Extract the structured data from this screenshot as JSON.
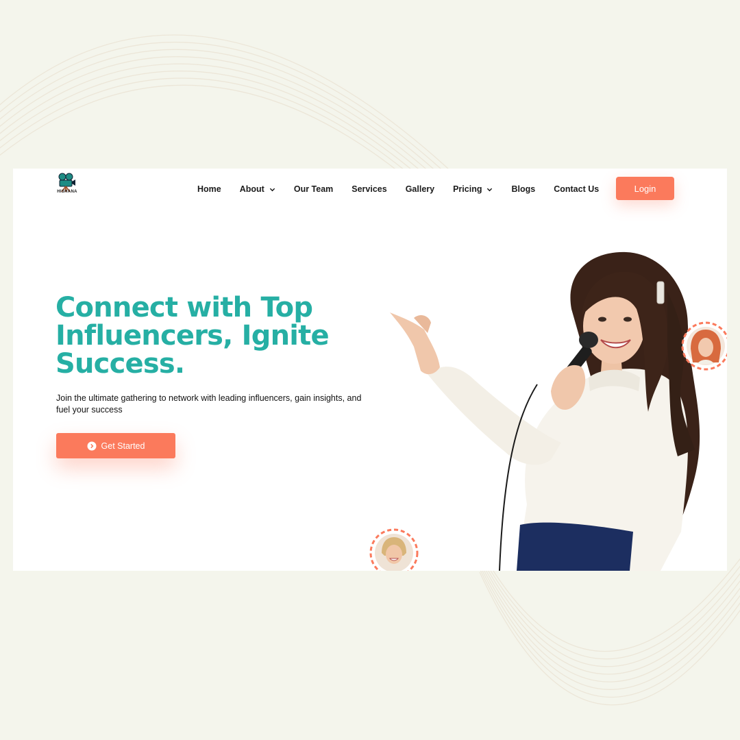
{
  "brand": {
    "name": "HISHANA"
  },
  "nav": {
    "items": [
      {
        "label": "Home",
        "dropdown": false
      },
      {
        "label": "About",
        "dropdown": true
      },
      {
        "label": "Our Team",
        "dropdown": false
      },
      {
        "label": "Services",
        "dropdown": false
      },
      {
        "label": "Gallery",
        "dropdown": false
      },
      {
        "label": "Pricing",
        "dropdown": true
      },
      {
        "label": "Blogs",
        "dropdown": false
      },
      {
        "label": "Contact Us",
        "dropdown": false
      }
    ],
    "login_label": "Login"
  },
  "hero": {
    "headline_lines": [
      "Connect with Top",
      "Influencers, Ignite",
      "Success."
    ],
    "subtitle": "Join the ultimate gathering to network with leading influencers, gain insights, and fuel your success",
    "cta_label": "Get Started",
    "cta_icon": "chevron-right-circle-icon"
  },
  "colors": {
    "accent": "#fb7a5c",
    "headline": "#26afa4",
    "background": "#f4f5ec",
    "panel": "#ffffff"
  }
}
